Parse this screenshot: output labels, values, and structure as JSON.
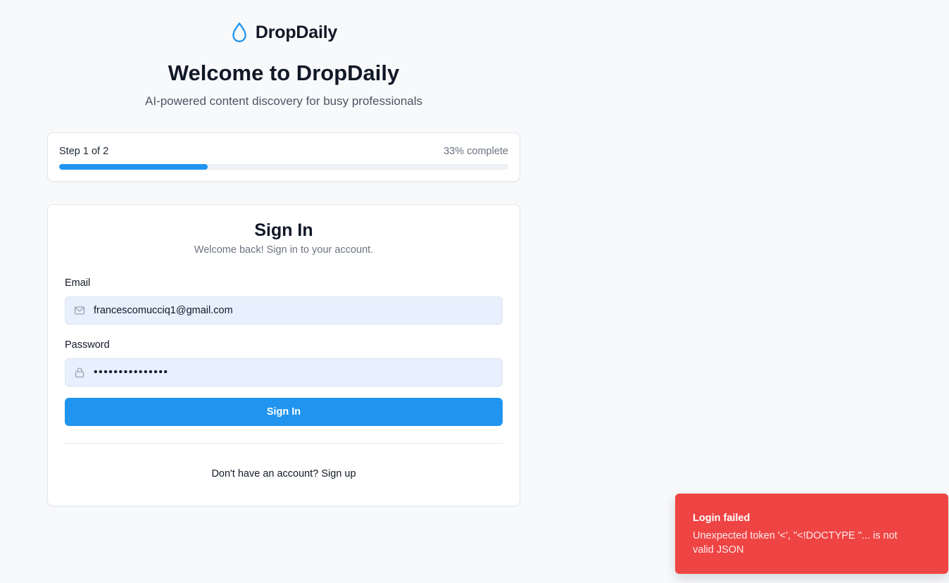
{
  "brand": {
    "name": "DropDaily",
    "accent_color": "#2094ef",
    "icon": "droplet-icon"
  },
  "hero": {
    "title": "Welcome to DropDaily",
    "subtitle": "AI-powered content discovery for busy professionals"
  },
  "progress": {
    "step_label": "Step 1 of 2",
    "percent_label": "33% complete",
    "percent_value": 33
  },
  "signin": {
    "title": "Sign In",
    "subtitle": "Welcome back! Sign in to your account.",
    "email_label": "Email",
    "email_value": "francescomucciq1@gmail.com",
    "email_icon": "mail-icon",
    "password_label": "Password",
    "password_value": "passwordpasswor",
    "password_icon": "lock-icon",
    "button_label": "Sign In",
    "signup_prompt": "Don't have an account?",
    "signup_link": "Sign up"
  },
  "toast": {
    "title": "Login failed",
    "message": "Unexpected token '<', \"<!DOCTYPE \"... is not valid JSON",
    "color": "#ef4444"
  }
}
